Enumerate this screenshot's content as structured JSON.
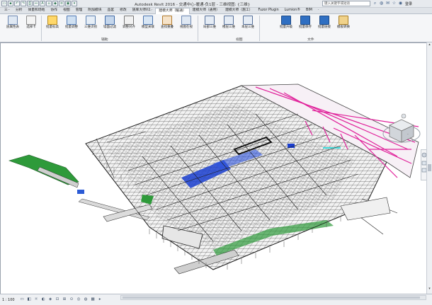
{
  "window": {
    "title": "Autodesk Revit 2016 - 交通中心-暖通-负1层 - 三维视图: {三维}",
    "search_placeholder": "键入关键字或短语",
    "login_label": "登录"
  },
  "quick_access": [
    "open-icon",
    "save-icon",
    "undo-icon",
    "redo-icon",
    "print-icon",
    "measure-icon",
    "text-icon",
    "3d-icon",
    "section-icon",
    "thin-lines-icon",
    "close-hidden-icon",
    "switch-windows-icon"
  ],
  "tabs": [
    {
      "label": "三··"
    },
    {
      "label": "分析"
    },
    {
      "label": "体量和场地"
    },
    {
      "label": "协作"
    },
    {
      "label": "视图"
    },
    {
      "label": "管理"
    },
    {
      "label": "附加模块"
    },
    {
      "label": "品茗"
    },
    {
      "label": "修改"
    },
    {
      "label": "族库大师V2.·"
    },
    {
      "label": "建模大师（暖通）",
      "active": true
    },
    {
      "label": "建模大师（通用）"
    },
    {
      "label": "建模大师（施工）"
    },
    {
      "label": "Fuzor Plugin"
    },
    {
      "label": "Lumion®"
    },
    {
      "label": "BIM"
    },
    {
      "label": "·"
    }
  ],
  "ribbon": {
    "buttons": [
      {
        "label": "族属性表",
        "icon": "family-table-icon"
      },
      {
        "label": "选择卡",
        "icon": "select-card-icon"
      },
      {
        "label": "批量标高",
        "icon": "batch-level-icon"
      },
      {
        "label": "批量调整",
        "icon": "batch-adjust-icon"
      },
      {
        "label": "三维识别",
        "icon": "3d-recognize-icon"
      },
      {
        "label": "墙面过滤",
        "icon": "wall-filter-icon"
      },
      {
        "label": "调整对齐",
        "icon": "align-icon"
      },
      {
        "label": "模型关联",
        "icon": "model-link-icon"
      },
      {
        "label": "查找重叠",
        "icon": "find-overlap-icon"
      },
      {
        "label": "视图在视",
        "icon": "view-icon"
      },
      {
        "label": "局部三维",
        "icon": "local-3d-icon"
      },
      {
        "label": "楼层三维",
        "icon": "floor-3d-icon"
      },
      {
        "label": "本层三维",
        "icon": "this-floor-3d-icon"
      },
      {
        "label": "批量升级",
        "icon": "batch-upgrade-icon"
      },
      {
        "label": "批量保存",
        "icon": "batch-save-icon"
      },
      {
        "label": "批量链接",
        "icon": "batch-link-icon"
      },
      {
        "label": "模板转换",
        "icon": "template-convert-icon"
      }
    ],
    "groups": [
      {
        "label": "辅助"
      },
      {
        "label": "视图"
      },
      {
        "label": "文件"
      }
    ]
  },
  "statusbar": {
    "scale": "1 : 100",
    "icons": [
      "detail-level-icon",
      "visual-style-icon",
      "sun-path-icon",
      "shadows-icon",
      "render-icon",
      "crop-icon",
      "show-crop-icon",
      "unlock-3d-icon",
      "temp-hide-icon",
      "reveal-hidden-icon",
      "worksharing-icon",
      "analytical-icon"
    ]
  },
  "viewcube": {
    "face_label": "·"
  },
  "colors": {
    "ribbon_bg": "#f5f6f8",
    "model_lines": "#2b2b2b",
    "duct_magenta": "#e0219a",
    "slab_blue": "#1b3fd0",
    "green_ramp": "#2e9a3a"
  }
}
